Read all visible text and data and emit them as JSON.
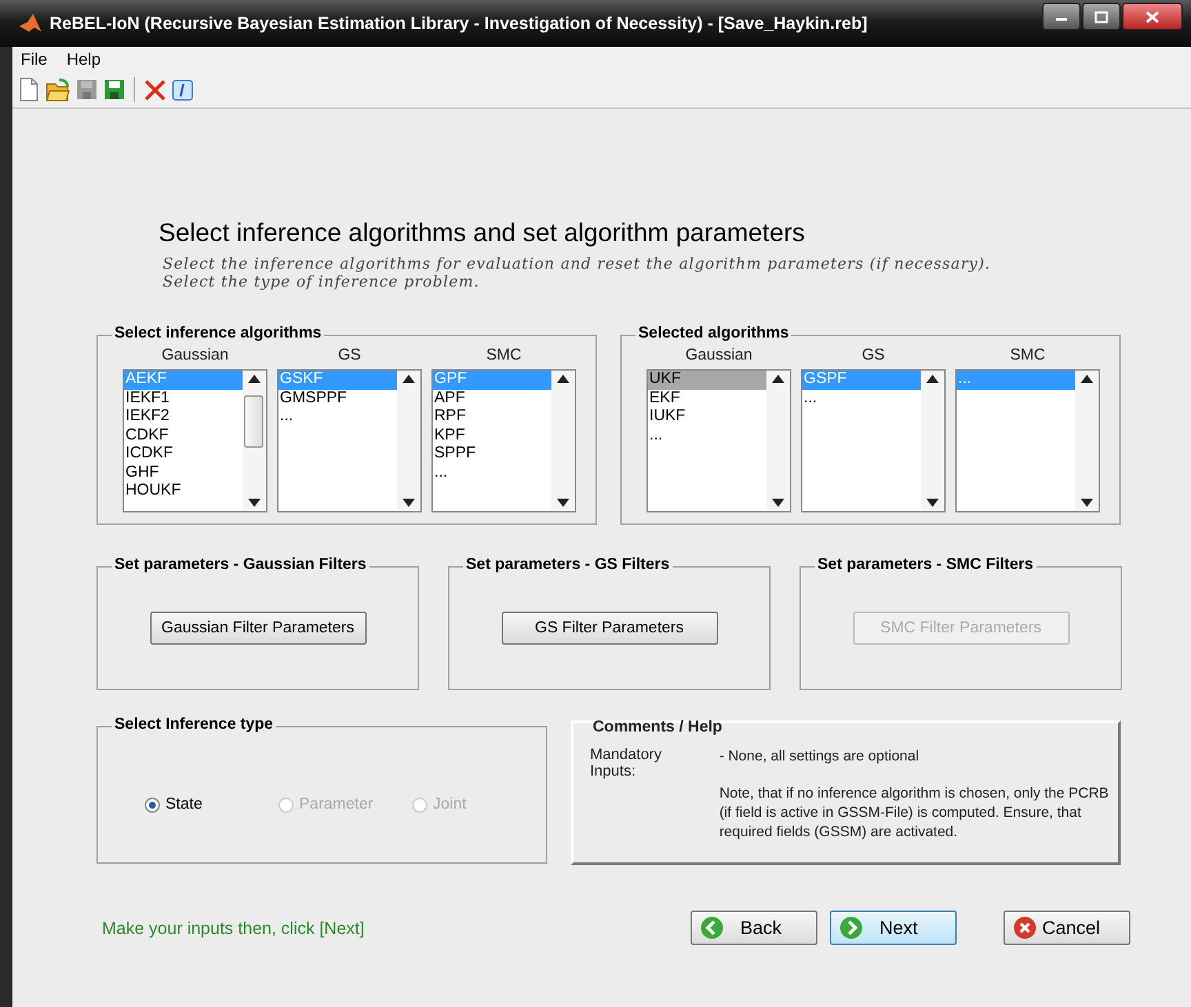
{
  "window": {
    "title": "ReBEL-IoN (Recursive Bayesian Estimation Library - Investigation of Necessity) - [Save_Haykin.reb]"
  },
  "menu": [
    "File",
    "Help"
  ],
  "toolbar": [
    {
      "kind": "new"
    },
    {
      "kind": "open"
    },
    {
      "kind": "save",
      "disabled": true
    },
    {
      "kind": "save",
      "disabled": false
    },
    {
      "kind": "sep"
    },
    {
      "kind": "delete"
    },
    {
      "kind": "info"
    }
  ],
  "heading": "Select inference algorithms and set algorithm parameters",
  "subtitle": [
    "Select the inference algorithms for evaluation and reset the algorithm parameters (if necessary).",
    "Select the type of inference problem."
  ],
  "algorithm_groups": [
    {
      "title": "Select inference algorithms",
      "lists": [
        {
          "label": "Gaussian",
          "focused": true,
          "scrollable": true,
          "items": [
            {
              "text": "AEKF",
              "selected": true
            },
            {
              "text": "IEKF1",
              "selected": false
            },
            {
              "text": "IEKF2",
              "selected": false
            },
            {
              "text": "CDKF",
              "selected": false
            },
            {
              "text": "ICDKF",
              "selected": false
            },
            {
              "text": "GHF",
              "selected": false
            },
            {
              "text": "HOUKF",
              "selected": false
            }
          ]
        },
        {
          "label": "GS",
          "focused": true,
          "scrollable": false,
          "items": [
            {
              "text": "GSKF",
              "selected": true
            },
            {
              "text": "GMSPPF",
              "selected": false
            },
            {
              "text": "...",
              "selected": false
            }
          ]
        },
        {
          "label": "SMC",
          "focused": true,
          "scrollable": false,
          "items": [
            {
              "text": "GPF",
              "selected": true
            },
            {
              "text": "APF",
              "selected": false
            },
            {
              "text": "RPF",
              "selected": false
            },
            {
              "text": "KPF",
              "selected": false
            },
            {
              "text": "SPPF",
              "selected": false
            },
            {
              "text": "...",
              "selected": false
            }
          ]
        }
      ]
    },
    {
      "title": "Selected algorithms",
      "lists": [
        {
          "label": "Gaussian",
          "focused": false,
          "scrollable": false,
          "items": [
            {
              "text": "UKF",
              "selected": true
            },
            {
              "text": "EKF",
              "selected": false
            },
            {
              "text": "IUKF",
              "selected": false
            },
            {
              "text": "...",
              "selected": false
            }
          ]
        },
        {
          "label": "GS",
          "focused": true,
          "scrollable": false,
          "items": [
            {
              "text": "GSPF",
              "selected": true
            },
            {
              "text": "...",
              "selected": false
            }
          ]
        },
        {
          "label": "SMC",
          "focused": true,
          "scrollable": false,
          "items": [
            {
              "text": "...",
              "selected": true
            }
          ]
        }
      ]
    }
  ],
  "parameter_groups": [
    {
      "title": "Set parameters - Gaussian Filters",
      "button": "Gaussian Filter Parameters",
      "disabled": false
    },
    {
      "title": "Set parameters - GS Filters",
      "button": "GS Filter Parameters",
      "disabled": false
    },
    {
      "title": "Set parameters - SMC Filters",
      "button": "SMC Filter Parameters",
      "disabled": true
    }
  ],
  "inference_type": {
    "title": "Select Inference type",
    "options": [
      {
        "label": "State",
        "selected": true,
        "disabled": false
      },
      {
        "label": "Parameter",
        "selected": false,
        "disabled": true
      },
      {
        "label": "Joint",
        "selected": false,
        "disabled": true
      }
    ]
  },
  "help": {
    "title": "Comments / Help",
    "label": "Mandatory Inputs:",
    "paragraphs": [
      "- None, all settings are optional",
      "Note, that if no inference algorithm is chosen, only the PCRB (if field is active in GSSM-File) is computed. Ensure, that required fields (GSSM) are activated."
    ]
  },
  "status": "Make your inputs then, click [Next]",
  "buttons": [
    {
      "kind": "back",
      "label": "Back",
      "default": false
    },
    {
      "kind": "next",
      "label": "Next",
      "default": true
    },
    {
      "kind": "cancel",
      "label": "Cancel",
      "default": false
    }
  ]
}
